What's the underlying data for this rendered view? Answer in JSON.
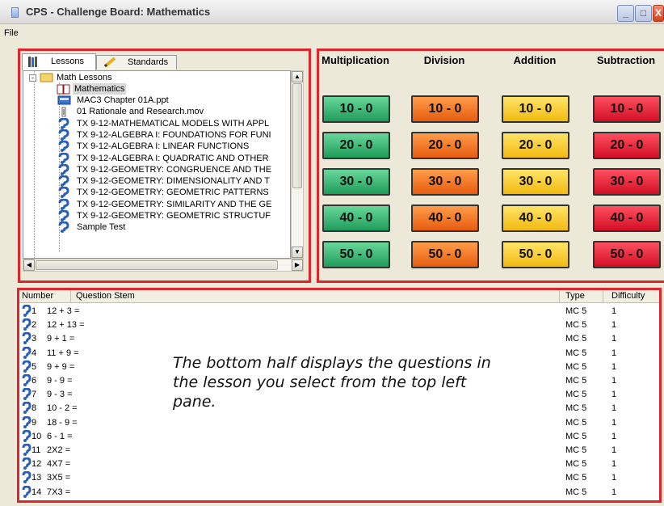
{
  "window": {
    "title": "CPS - Challenge Board: Mathematics",
    "minimize": "_",
    "maximize": "□",
    "close": "X"
  },
  "menu": {
    "file": "File"
  },
  "tabs": {
    "lessons": "Lessons",
    "standards": "Standards"
  },
  "tree": {
    "root": "Math Lessons",
    "selected": "Mathematics",
    "items": [
      {
        "label": "MAC3 Chapter 01A.ppt",
        "icon": "ppt-file-icon"
      },
      {
        "label": "01 Rationale and Research.mov",
        "icon": "movie-file-icon"
      },
      {
        "label": "TX 9-12-MATHEMATICAL MODELS WITH APPL",
        "icon": "question-set-icon"
      },
      {
        "label": "TX 9-12-ALGEBRA I: FOUNDATIONS FOR FUNI",
        "icon": "question-set-icon"
      },
      {
        "label": "TX 9-12-ALGEBRA I: LINEAR FUNCTIONS",
        "icon": "question-set-icon"
      },
      {
        "label": "TX 9-12-ALGEBRA I: QUADRATIC AND OTHER",
        "icon": "question-set-icon"
      },
      {
        "label": "TX 9-12-GEOMETRY: CONGRUENCE AND THE",
        "icon": "question-set-icon"
      },
      {
        "label": "TX 9-12-GEOMETRY: DIMENSIONALITY AND T",
        "icon": "question-set-icon"
      },
      {
        "label": "TX 9-12-GEOMETRY: GEOMETRIC PATTERNS",
        "icon": "question-set-icon"
      },
      {
        "label": "TX 9-12-GEOMETRY: SIMILARITY AND THE GE",
        "icon": "question-set-icon"
      },
      {
        "label": "TX 9-12-GEOMETRY: GEOMETRIC STRUCTUF",
        "icon": "question-set-icon"
      },
      {
        "label": "Sample Test",
        "icon": "question-set-icon"
      }
    ]
  },
  "board": {
    "categories": [
      "Multiplication",
      "Division",
      "Addition",
      "Subtraction"
    ],
    "tiles": [
      "10 - 0",
      "20 - 0",
      "30 - 0",
      "40 - 0",
      "50 - 0"
    ]
  },
  "questions": {
    "headers": {
      "number": "Number",
      "stem": "Question Stem",
      "type": "Type",
      "difficulty": "Difficulty"
    },
    "rows": [
      {
        "number": "1",
        "stem": "12 + 3 =",
        "type": "MC 5",
        "difficulty": "1"
      },
      {
        "number": "2",
        "stem": "12 + 13 =",
        "type": "MC 5",
        "difficulty": "1"
      },
      {
        "number": "3",
        "stem": "9 + 1 =",
        "type": "MC 5",
        "difficulty": "1"
      },
      {
        "number": "4",
        "stem": "11 + 9 =",
        "type": "MC 5",
        "difficulty": "1"
      },
      {
        "number": "5",
        "stem": "9 + 9 =",
        "type": "MC 5",
        "difficulty": "1"
      },
      {
        "number": "6",
        "stem": "9 - 9 =",
        "type": "MC 5",
        "difficulty": "1"
      },
      {
        "number": "7",
        "stem": "9 - 3 =",
        "type": "MC 5",
        "difficulty": "1"
      },
      {
        "number": "8",
        "stem": "10 - 2 =",
        "type": "MC 5",
        "difficulty": "1"
      },
      {
        "number": "9",
        "stem": "18 - 9 =",
        "type": "MC 5",
        "difficulty": "1"
      },
      {
        "number": "10",
        "stem": "6 - 1 =",
        "type": "MC 5",
        "difficulty": "1"
      },
      {
        "number": "11",
        "stem": "2X2 =",
        "type": "MC 5",
        "difficulty": "1"
      },
      {
        "number": "12",
        "stem": "4X7 =",
        "type": "MC 5",
        "difficulty": "1"
      },
      {
        "number": "13",
        "stem": "3X5 =",
        "type": "MC 5",
        "difficulty": "1"
      },
      {
        "number": "14",
        "stem": "7X3 =",
        "type": "MC 5",
        "difficulty": "1"
      }
    ]
  },
  "annotation": "The bottom half displays the questions in the lesson you select from the top left pane.",
  "colors": {
    "highlight_border": "#e0242b",
    "multiplication": "#2aa862",
    "division": "#f06a1c",
    "addition": "#f8c620",
    "subtraction": "#dc1a2c"
  }
}
